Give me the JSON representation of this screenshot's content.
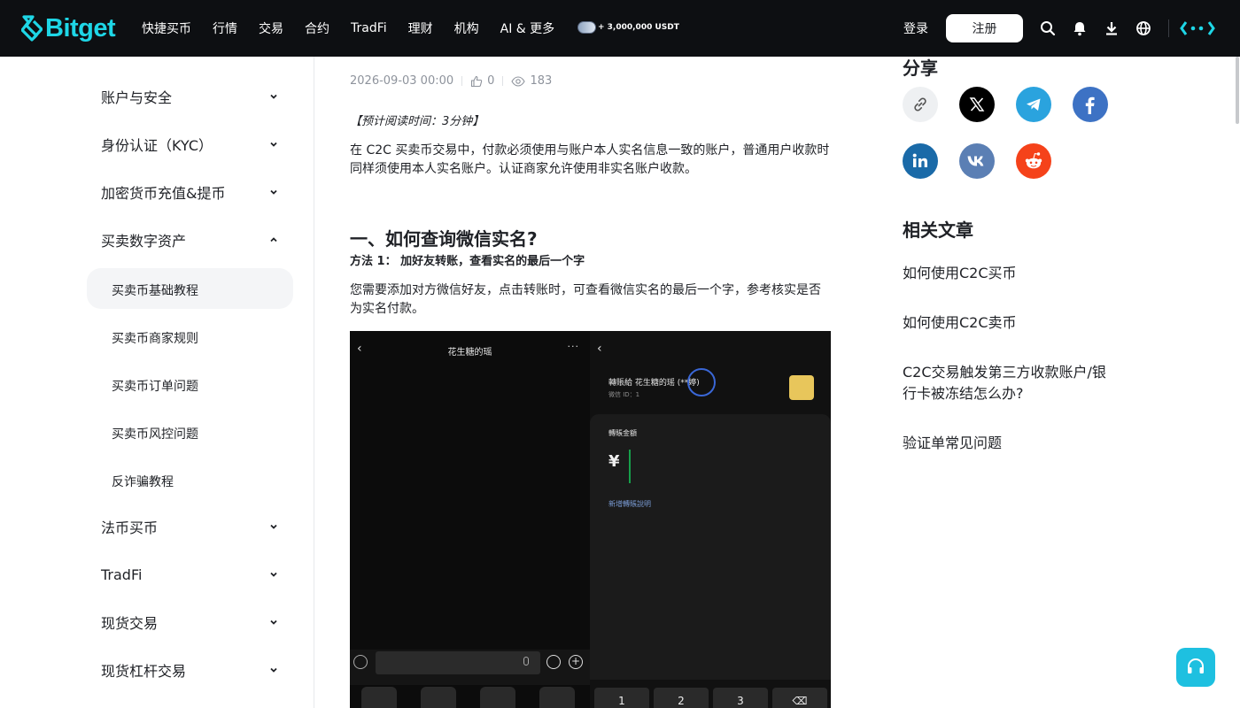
{
  "brand": {
    "name": "Bitget",
    "accent": "#1ed6e6"
  },
  "nav": {
    "items": [
      "快捷买币",
      "行情",
      "交易",
      "合约",
      "TradFi",
      "理财",
      "机构",
      "AI & 更多"
    ],
    "promo_text": "+ 3,000,000 USDT",
    "login": "登录",
    "signup": "注册",
    "icons": [
      "search-icon",
      "bell-icon",
      "download-icon",
      "globe-icon",
      "brand-mark-icon"
    ]
  },
  "sidebar": {
    "sections": [
      {
        "label": "账户与安全",
        "expanded": false
      },
      {
        "label": "身份认证（KYC）",
        "expanded": false
      },
      {
        "label": "加密货币充值&提币",
        "expanded": false
      },
      {
        "label": "买卖数字资产",
        "expanded": true
      },
      {
        "label": "法币买币",
        "expanded": false
      },
      {
        "label": "TradFi",
        "expanded": false
      },
      {
        "label": "现货交易",
        "expanded": false
      },
      {
        "label": "现货杠杆交易",
        "expanded": false
      }
    ],
    "subitems": [
      {
        "label": "买卖币基础教程",
        "active": true
      },
      {
        "label": "买卖币商家规则",
        "active": false
      },
      {
        "label": "买卖币订单问题",
        "active": false
      },
      {
        "label": "买卖币风控问题",
        "active": false
      },
      {
        "label": "反诈骗教程",
        "active": false
      }
    ]
  },
  "article": {
    "date": "2026-09-03 00:00",
    "likes": "0",
    "views": "183",
    "reading_time": "【预计阅读时间：3分钟】",
    "intro": "在 C2C 买卖币交易中，付款必须使用与账户本人实名信息一致的账户，普通用户收款时同样须使用本人实名账户。认证商家允许使用非实名账户收款。",
    "heading": "一、如何查询微信实名?",
    "method": "方法 1： 加好友转账，查看实名的最后一个字",
    "description": "您需要添加对方微信好友，点击转账时，可查看微信实名的最后一个字，参考核实是否为实名付款。",
    "screenshot": {
      "chat_title": "花生糖的瑶",
      "more": "···",
      "transfer_to": "轉賬給 花生糖的瑶 (**婷)",
      "wechat_id": "微信 ID：1",
      "amount_label": "轉賬金額",
      "currency": "¥",
      "add_note": "新增轉賬說明",
      "keys": [
        "1",
        "2",
        "3",
        "⌫"
      ]
    }
  },
  "right": {
    "share_title": "分享",
    "share_buttons": [
      {
        "name": "copy-link",
        "color": "#eef0f2"
      },
      {
        "name": "x",
        "color": "#000000"
      },
      {
        "name": "telegram",
        "color": "#2aa3de"
      },
      {
        "name": "facebook",
        "color": "#3d72c4"
      },
      {
        "name": "linkedin",
        "color": "#1a6aa8"
      },
      {
        "name": "vk",
        "color": "#5b7fb4"
      },
      {
        "name": "reddit",
        "color": "#f5421a"
      }
    ],
    "related_title": "相关文章",
    "related": [
      "如何使用C2C买币",
      "如何使用C2C卖币",
      "C2C交易触发第三方收款账户/银行卡被冻结怎么办?",
      "验证单常见问题"
    ]
  }
}
